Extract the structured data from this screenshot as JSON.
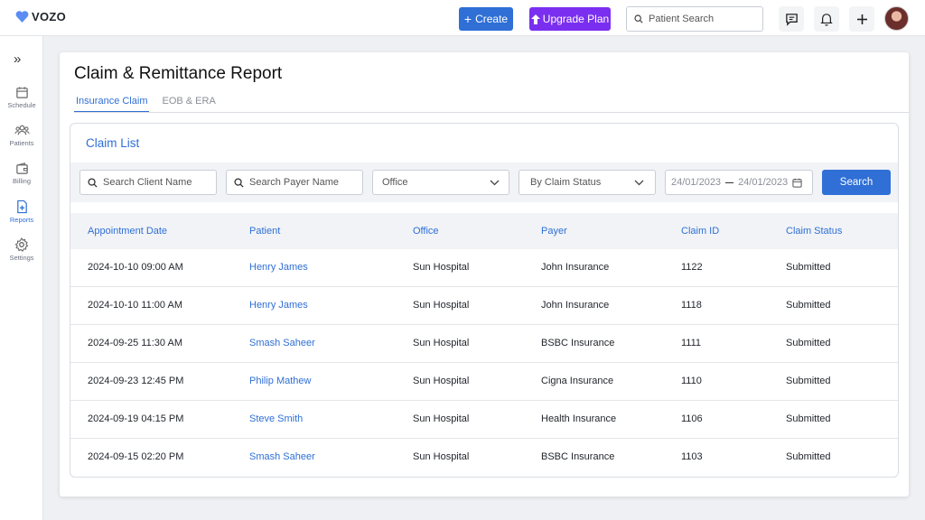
{
  "app": {
    "logo_text": "VOZO"
  },
  "header": {
    "create_label": "Create",
    "upgrade_label": "Upgrade Plan",
    "patient_search_placeholder": "Patient Search"
  },
  "sidebar": {
    "items": [
      {
        "label": "Schedule",
        "icon": "calendar-icon"
      },
      {
        "label": "Patients",
        "icon": "users-icon"
      },
      {
        "label": "Billing",
        "icon": "wallet-icon"
      },
      {
        "label": "Reports",
        "icon": "report-icon",
        "active": true
      },
      {
        "label": "Settings",
        "icon": "gear-icon"
      }
    ]
  },
  "page": {
    "title": "Claim & Remittance Report",
    "tabs": [
      {
        "label": "Insurance Claim",
        "active": true
      },
      {
        "label": "EOB & ERA",
        "active": false
      }
    ]
  },
  "claim_list": {
    "title": "Claim List",
    "filters": {
      "client_placeholder": "Search Client Name",
      "payer_placeholder": "Search Payer Name",
      "office_label": "Office",
      "status_label": "By Claim Status",
      "date_from": "24/01/2023",
      "date_to": "24/01/2023",
      "search_label": "Search"
    },
    "columns": [
      "Appointment Date",
      "Patient",
      "Office",
      "Payer",
      "Claim ID",
      "Claim Status"
    ],
    "rows": [
      [
        "2024-10-10 09:00 AM",
        "Henry James",
        "Sun Hospital",
        "John Insurance",
        "1122",
        "Submitted"
      ],
      [
        "2024-10-10 11:00 AM",
        "Henry James",
        "Sun Hospital",
        "John Insurance",
        "1118",
        "Submitted"
      ],
      [
        "2024-09-25 11:30 AM",
        "Smash Saheer",
        "Sun Hospital",
        "BSBC Insurance",
        "1111",
        "Submitted"
      ],
      [
        "2024-09-23 12:45 PM",
        "Philip Mathew",
        "Sun Hospital",
        "Cigna Insurance",
        "1110",
        "Submitted"
      ],
      [
        "2024-09-19 04:15 PM",
        "Steve Smith",
        "Sun Hospital",
        "Health Insurance",
        "1106",
        "Submitted"
      ],
      [
        "2024-09-15 02:20 PM",
        "Smash Saheer",
        "Sun Hospital",
        "BSBC Insurance",
        "1103",
        "Submitted"
      ]
    ]
  },
  "colors": {
    "primary": "#2f6fd6",
    "upgrade": "#7a2ff0",
    "logo_heart": "#5b8cf5"
  }
}
